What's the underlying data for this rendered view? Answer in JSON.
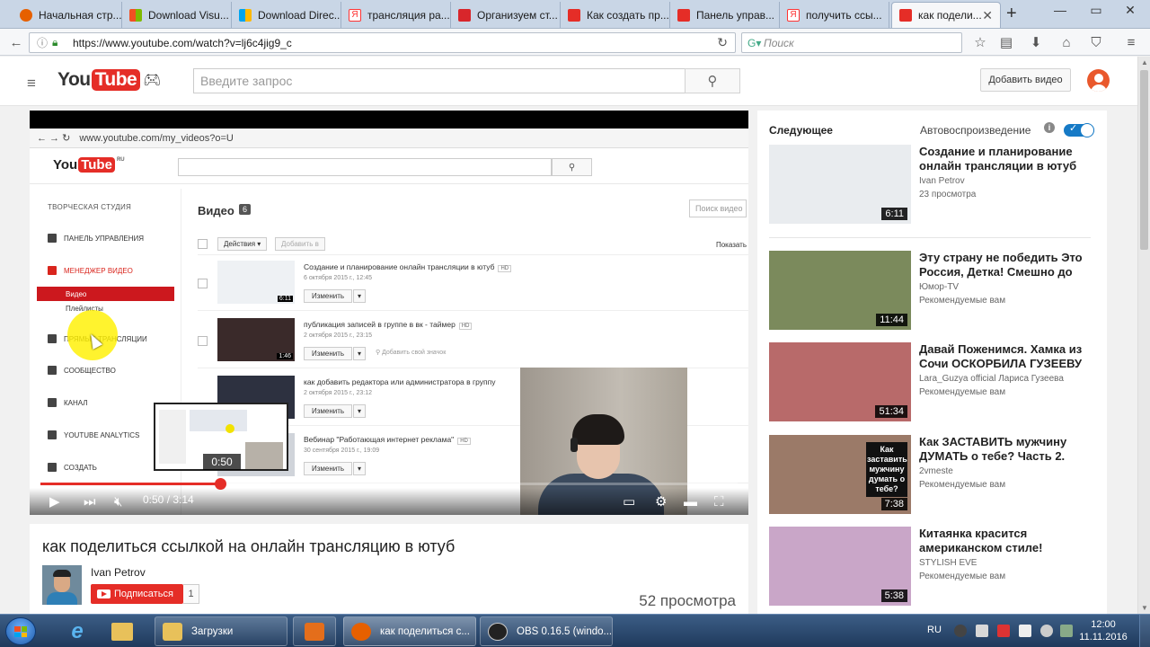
{
  "browser": {
    "tabs": [
      {
        "label": "Начальная стр...",
        "color": "#e66000"
      },
      {
        "label": "Download Visu...",
        "color": "#7fba00"
      },
      {
        "label": "Download Direc...",
        "color": "#7fba00"
      },
      {
        "label": "трансляция ра...",
        "color": "#ff3333"
      },
      {
        "label": "Организуем ст...",
        "color": "#d8262b"
      },
      {
        "label": "Как создать пр...",
        "color": "#e52d27"
      },
      {
        "label": "Панель управ...",
        "color": "#e52d27"
      },
      {
        "label": "получить ссы...",
        "color": "#ff3333"
      },
      {
        "label": "как подели...",
        "color": "#e52d27"
      }
    ],
    "url": "https://www.youtube.com/watch?v=lj6c4jig9_c",
    "search_placeholder": "Поиск"
  },
  "youtube": {
    "search_placeholder": "Введите запрос",
    "upload_label": "Добавить видео",
    "logo_you": "You",
    "logo_tube": "Tube"
  },
  "player": {
    "inner": {
      "url": "www.youtube.com/my_videos?o=U",
      "logo_you": "You",
      "logo_tube": "Tube",
      "logo_region": "RU",
      "studio_header": "ТВОРЧЕСКАЯ СТУДИЯ",
      "nav": {
        "dashboard": "ПАНЕЛЬ УПРАВЛЕНИЯ",
        "video_manager": "МЕНЕДЖЕР ВИДЕО",
        "videos": "Видео",
        "playlists": "Плейлисты",
        "live": "ПРЯМЫЕ ТРАНСЛЯЦИИ",
        "community": "СООБЩЕСТВО",
        "channel": "КАНАЛ",
        "analytics": "YOUTUBE ANALYTICS",
        "create": "СОЗДАТЬ"
      },
      "videos_title": "Видео",
      "videos_count": "6",
      "search_videos": "Поиск видео",
      "actions": "Действия",
      "add_to": "Добавить в",
      "show": "Показать",
      "edit": "Изменить",
      "hd": "HD",
      "add_icon_label": "Добавить свой значок",
      "rows": [
        {
          "title": "Создание и планирование онлайн трансляции в ютуб",
          "date": "6 октября 2015 г., 12:45",
          "duration": "6:11"
        },
        {
          "title": "публикация записей в группе в вк - таймер",
          "date": "2 октября 2015 г., 23:15",
          "duration": "1:46"
        },
        {
          "title": "как добавить редактора или администратора в группу",
          "date": "2 октября 2015 г., 23:12",
          "duration": ""
        },
        {
          "title": "Вебинар \"Работающая интернет реклама\"",
          "date": "30 сентября 2015 г., 19:09",
          "duration": ""
        }
      ]
    },
    "hover_time": "0:50",
    "current_time": "0:50",
    "duration": "3:14",
    "time_display": "0:50 / 3:14",
    "progress_fraction": 0.2577,
    "buffered_fraction": 0.33
  },
  "video": {
    "title": "как поделиться ссылкой на онлайн трансляцию в ютуб",
    "channel": "Ivan Petrov",
    "subscribe_label": "Подписаться",
    "subscriber_count": "1",
    "views": "52 просмотра"
  },
  "sidebar": {
    "next_label": "Следующее",
    "autoplay_label": "Автовоспроизведение",
    "autoplay_on": true,
    "videos": [
      {
        "title": "Создание и планирование онлайн трансляции в ютуб",
        "channel": "Ivan Petrov",
        "meta": "23 просмотра",
        "duration": "6:11",
        "thumb_color": "#e9ecef"
      },
      {
        "title": "Эту страну не победить Это Россия, Детка! Смешно до",
        "channel": "Юмор-TV",
        "meta": "Рекомендуемые вам",
        "duration": "11:44",
        "thumb_color": "#7b8a5c"
      },
      {
        "title": "Давай Поженимся. Хамка из Сочи ОСКОРБИЛА ГУЗЕЕВУ",
        "channel": "Lara_Guzya official Лариса Гузеева",
        "meta": "Рекомендуемые вам",
        "duration": "51:34",
        "thumb_color": "#b86a6a"
      },
      {
        "title": "Как ЗАСТАВИТЬ мужчину ДУМАТЬ о тебе? Часть 2.",
        "channel": "2vmeste",
        "meta": "Рекомендуемые вам",
        "duration": "7:38",
        "thumb_color": "#9b7a68",
        "thumb_text": "Как заставить мужчину думать о тебе?"
      },
      {
        "title": "Китаянка красится американском стиле!",
        "channel": "STYLISH EVE",
        "meta": "Рекомендуемые вам",
        "duration": "5:38",
        "thumb_color": "#c9a6c8"
      }
    ]
  },
  "taskbar": {
    "apps": [
      {
        "label": "Загрузки",
        "color": "#e8c15a"
      },
      {
        "label": "",
        "color": "#e46e1b"
      },
      {
        "label": "как поделиться с...",
        "color": "#e66000"
      },
      {
        "label": "OBS 0.16.5 (windo...",
        "color": "#222"
      }
    ],
    "language": "RU",
    "time": "12:00",
    "date": "11.11.2016"
  }
}
